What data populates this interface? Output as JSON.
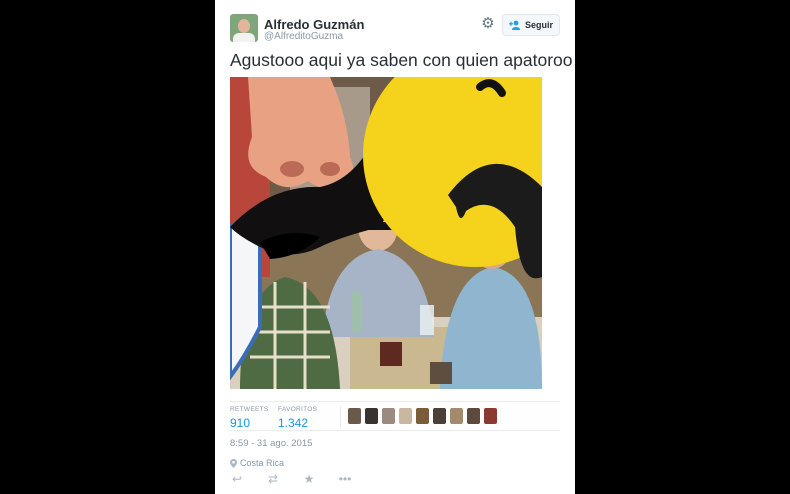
{
  "author": {
    "display_name": "Alfredo Guzmán",
    "handle": "@AlfreditoGuzma"
  },
  "follow_button_label": "Seguir",
  "tweet_text": "Agustooo aqui ya saben con quien apatoroo",
  "media": {
    "description": "photo",
    "overlays": [
      "nose-sticker",
      "mustache-sticker",
      "crying-emoji-sticker"
    ]
  },
  "stats": {
    "retweets_label": "RETWEETS",
    "retweets_value": "910",
    "favorites_label": "FAVORITOS",
    "favorites_value": "1.342"
  },
  "favoriters_colors": [
    "#6b5a4a",
    "#3a3230",
    "#9a8a80",
    "#c9b8a0",
    "#7a5c3a",
    "#4b4038",
    "#a48a6a",
    "#5d4a3f",
    "#8a3a30"
  ],
  "timestamp": "8:59 - 31 ago. 2015",
  "location": "Costa Rica",
  "actions": [
    "reply-icon",
    "retweet-icon",
    "favorite-icon",
    "more-icon"
  ]
}
